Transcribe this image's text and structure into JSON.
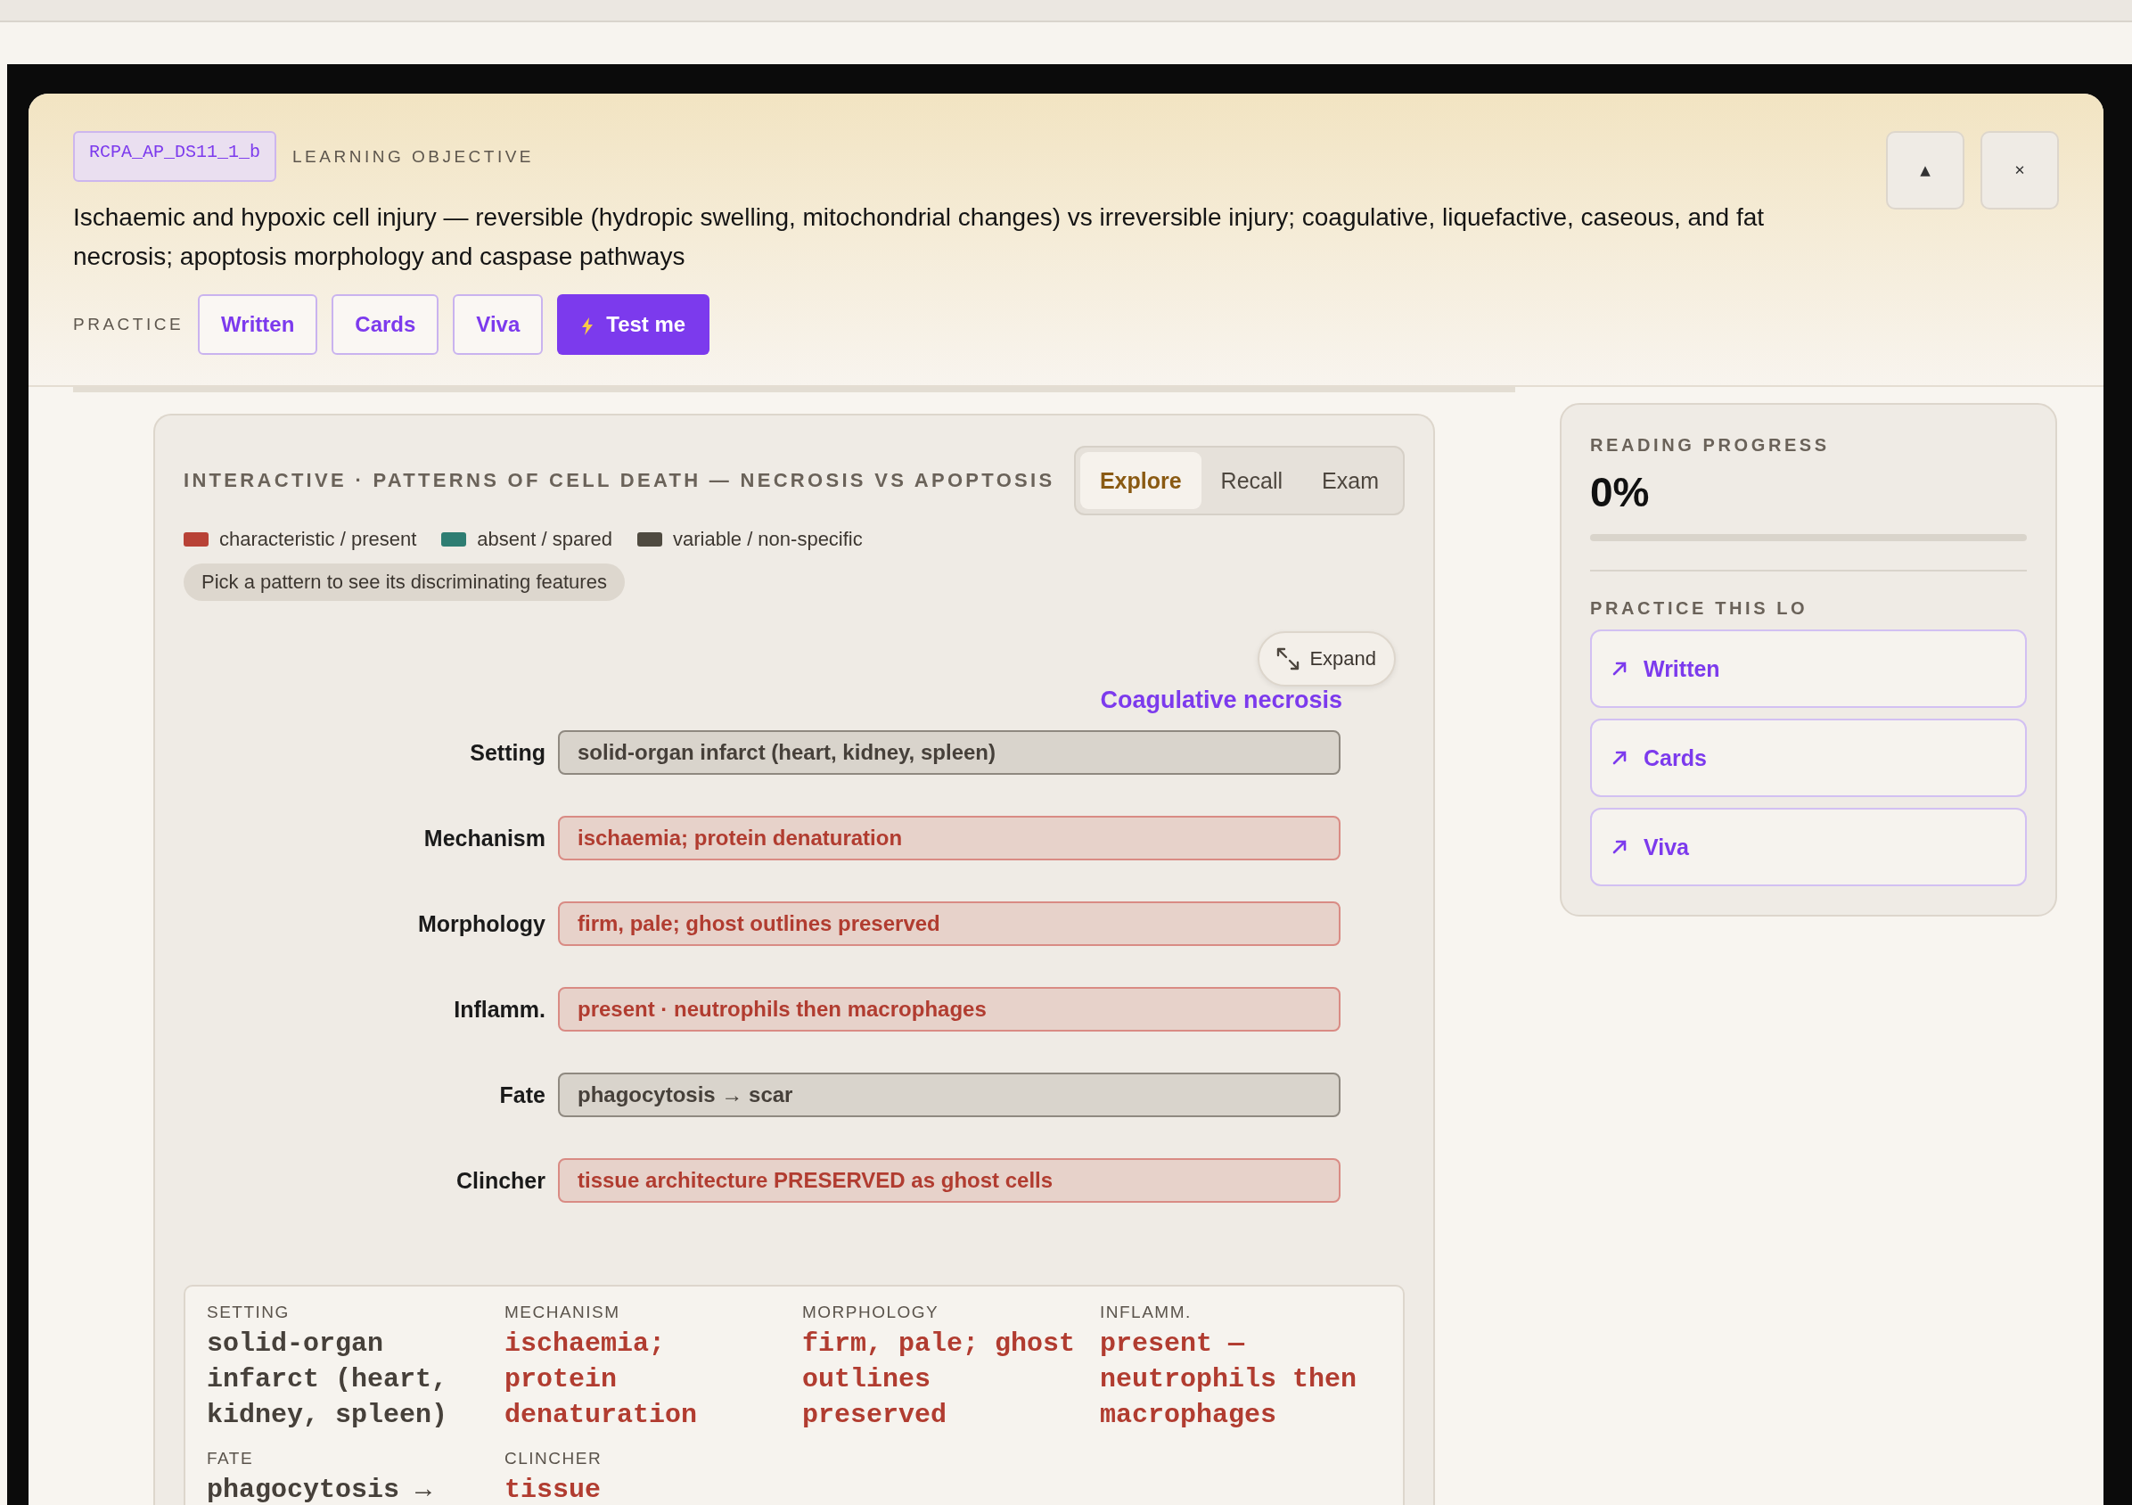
{
  "objective": {
    "code": "RCPA_AP_DS11_1_b",
    "label": "LEARNING OBJECTIVE",
    "text": "Ischaemic and hypoxic cell injury — reversible (hydropic swelling, mitochondrial changes) vs irreversible injury; coagulative, liquefactive, caseous, and fat necrosis; apoptosis morphology and caspase pathways",
    "collapse_icon": "▲",
    "close_icon": "✕"
  },
  "practice": {
    "label": "PRACTICE",
    "buttons": [
      {
        "label": "Written",
        "kind": "outline"
      },
      {
        "label": "Cards",
        "kind": "outline"
      },
      {
        "label": "Viva",
        "kind": "outline"
      },
      {
        "label": "Test me",
        "kind": "primary"
      }
    ]
  },
  "interactive": {
    "title": "INTERACTIVE · PATTERNS OF CELL DEATH — NECROSIS VS APOPTOSIS",
    "modes": [
      {
        "label": "Explore",
        "selected": true
      },
      {
        "label": "Recall",
        "selected": false
      },
      {
        "label": "Exam",
        "selected": false
      }
    ],
    "legend": [
      {
        "label": "characteristic / present",
        "color": "#b84236"
      },
      {
        "label": "absent / spared",
        "color": "#2e7d72"
      },
      {
        "label": "variable / non-specific",
        "color": "#4f4a40"
      }
    ],
    "hint": "Pick a pattern to see its discriminating features",
    "expand": "Expand",
    "pattern": "Coagulative necrosis",
    "rows": [
      {
        "label": "Setting",
        "value": "solid-organ infarct (heart, kidney, spleen)",
        "kind": "variable"
      },
      {
        "label": "Mechanism",
        "value": "ischaemia; protein denaturation",
        "kind": "present"
      },
      {
        "label": "Morphology",
        "value": "firm, pale; ghost outlines preserved",
        "kind": "present"
      },
      {
        "label": "Inflamm.",
        "value": "present · neutrophils then macrophages",
        "kind": "present"
      },
      {
        "label": "Fate",
        "value": "phagocytosis → scar",
        "kind": "variable"
      },
      {
        "label": "Clincher",
        "value": "tissue architecture PRESERVED as ghost cells",
        "kind": "present"
      }
    ],
    "summary": [
      {
        "label": "SETTING",
        "value": "solid-organ infarct (heart, kidney, spleen)",
        "kind": "variable"
      },
      {
        "label": "MECHANISM",
        "value": "ischaemia; protein denaturation",
        "kind": "present"
      },
      {
        "label": "MORPHOLOGY",
        "value": "firm, pale; ghost outlines preserved",
        "kind": "present"
      },
      {
        "label": "INFLAMM.",
        "value": "present — neutrophils then macrophages",
        "kind": "present"
      },
      {
        "label": "FATE",
        "value": "phagocytosis →",
        "kind": "variable"
      },
      {
        "label": "CLINCHER",
        "value": "tissue",
        "kind": "present"
      }
    ]
  },
  "sidebar": {
    "progress_label": "READING PROGRESS",
    "progress_value": "0%",
    "progress": {
      "level": 0
    },
    "practice_label": "PRACTICE THIS LO",
    "links": [
      {
        "label": "Written"
      },
      {
        "label": "Cards"
      },
      {
        "label": "Viva"
      }
    ]
  }
}
